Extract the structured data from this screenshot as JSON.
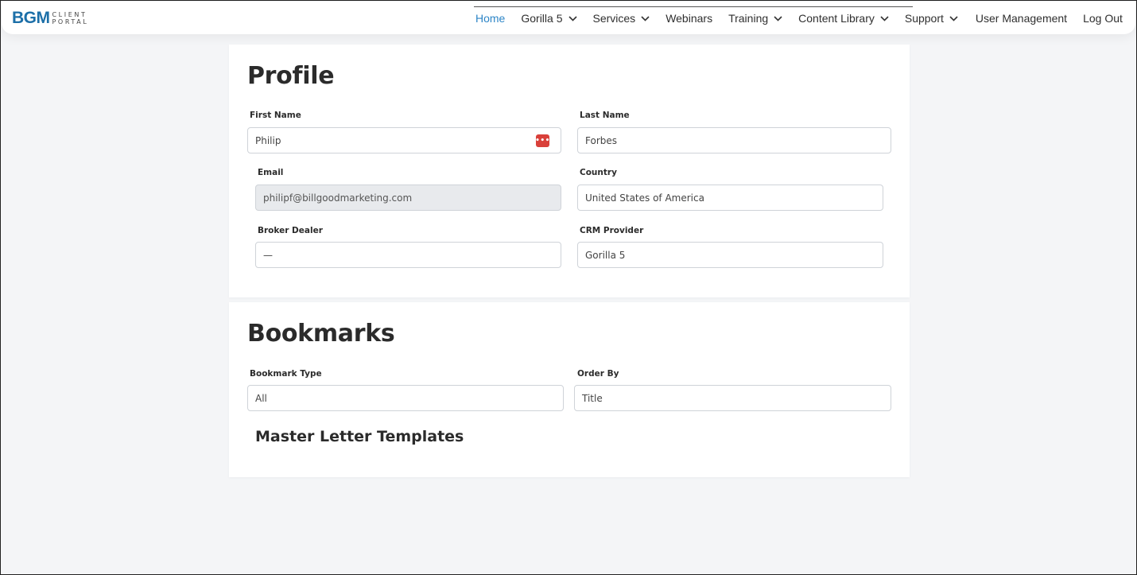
{
  "brand": {
    "logo_main": "BGM",
    "logo_line1": "CLIENT",
    "logo_line2": "PORTAL",
    "color": "#1c6fa8"
  },
  "nav": {
    "items": [
      {
        "label": "Home",
        "active": true,
        "dropdown": false
      },
      {
        "label": "Gorilla 5",
        "active": false,
        "dropdown": true
      },
      {
        "label": "Services",
        "active": false,
        "dropdown": true
      },
      {
        "label": "Webinars",
        "active": false,
        "dropdown": false
      },
      {
        "label": "Training",
        "active": false,
        "dropdown": true
      },
      {
        "label": "Content Library",
        "active": false,
        "dropdown": true
      },
      {
        "label": "Support",
        "active": false,
        "dropdown": true
      },
      {
        "label": "User Management",
        "active": false,
        "dropdown": false
      },
      {
        "label": "Log Out",
        "active": false,
        "dropdown": false
      }
    ],
    "active_color": "#2e86c7"
  },
  "profile": {
    "title": "Profile",
    "first_name": {
      "label": "First Name",
      "value": "Philip"
    },
    "last_name": {
      "label": "Last Name",
      "value": "Forbes"
    },
    "email": {
      "label": "Email",
      "value": "philipf@billgoodmarketing.com"
    },
    "country": {
      "label": "Country",
      "value": "United States of America"
    },
    "broker_dealer": {
      "label": "Broker Dealer",
      "value": "—"
    },
    "crm_provider": {
      "label": "CRM Provider",
      "value": "Gorilla 5"
    },
    "password_manager_icon": "password-manager-icon",
    "password_manager_text": "•••"
  },
  "bookmarks": {
    "title": "Bookmarks",
    "bookmark_type": {
      "label": "Bookmark Type",
      "value": "All"
    },
    "order_by": {
      "label": "Order By",
      "value": "Title"
    },
    "section_title": "Master Letter Templates"
  }
}
